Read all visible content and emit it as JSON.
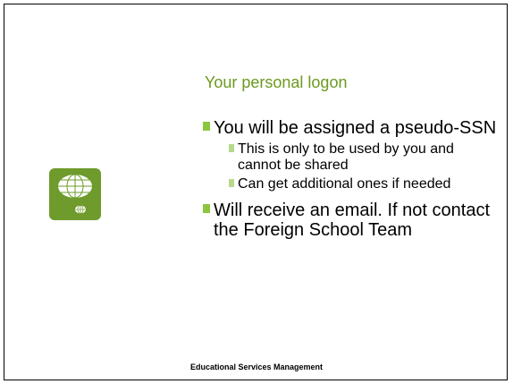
{
  "slide": {
    "title": "Your personal logon",
    "bullets": [
      {
        "text": "You will be assigned a pseudo-SSN",
        "sub": [
          "This is only to be used by you and cannot be shared",
          "Can get additional ones if needed"
        ]
      },
      {
        "text": "Will receive an email.  If not contact the Foreign School Team",
        "sub": []
      }
    ],
    "footer": "Educational  Services Management"
  },
  "colors": {
    "title": "#6b9a1e",
    "bullet_marker": "#8cc63f",
    "sub_bullet_marker": "#b7d98a",
    "logo_bg": "#6e9b2b"
  },
  "icons": {
    "logo": "globe-logo-icon"
  }
}
